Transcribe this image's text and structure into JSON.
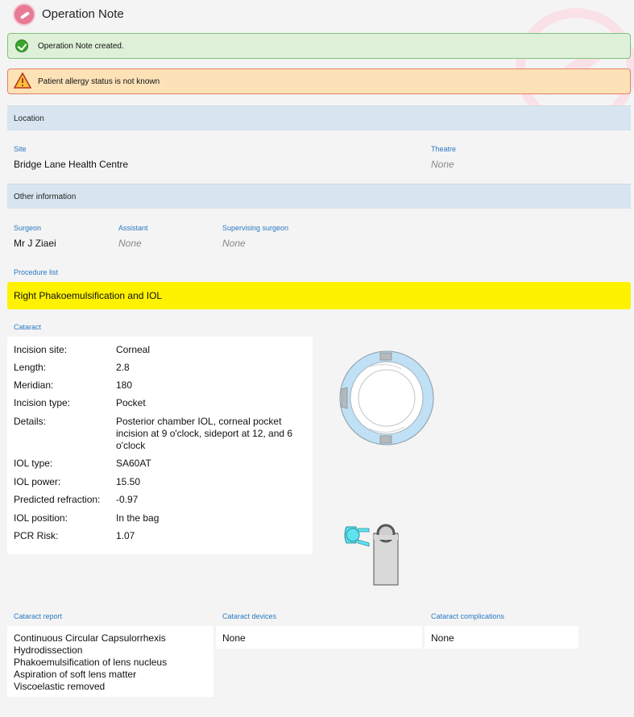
{
  "header": {
    "title": "Operation Note"
  },
  "alerts": {
    "success": "Operation Note created.",
    "warning": "Patient allergy status is not known"
  },
  "location": {
    "heading": "Location",
    "site_label": "Site",
    "site_value": "Bridge Lane Health Centre",
    "theatre_label": "Theatre",
    "theatre_value": "None"
  },
  "other": {
    "heading": "Other information",
    "surgeon_label": "Surgeon",
    "surgeon_value": "Mr J Ziaei",
    "assistant_label": "Assistant",
    "assistant_value": "None",
    "supervising_label": "Supervising surgeon",
    "supervising_value": "None"
  },
  "procedure": {
    "label": "Procedure list",
    "item": "Right Phakoemulsification and IOL"
  },
  "cataract": {
    "label": "Cataract",
    "rows": [
      {
        "label": "Incision site:",
        "value": "Corneal"
      },
      {
        "label": "Length:",
        "value": "2.8"
      },
      {
        "label": "Meridian:",
        "value": "180"
      },
      {
        "label": "Incision type:",
        "value": "Pocket"
      },
      {
        "label": "Details:",
        "value": "Posterior chamber IOL, corneal pocket incision at 9 o'clock, sideport at 12, and 6 o'clock"
      },
      {
        "label": "IOL type:",
        "value": "SA60AT"
      },
      {
        "label": "IOL power:",
        "value": "15.50"
      },
      {
        "label": "Predicted refraction:",
        "value": "-0.97"
      },
      {
        "label": "IOL position:",
        "value": "In the bag"
      },
      {
        "label": "PCR Risk:",
        "value": "1.07"
      }
    ]
  },
  "report": {
    "label": "Cataract report",
    "lines": [
      "Continuous Circular Capsulorrhexis",
      "Hydrodissection",
      "Phakoemulsification of lens nucleus",
      "Aspiration of soft lens matter",
      "Viscoelastic removed"
    ]
  },
  "devices": {
    "label": "Cataract devices",
    "value": "None"
  },
  "complications": {
    "label": "Cataract complications",
    "value": "None"
  },
  "colors": {
    "label_blue": "#2a79c4",
    "section_bar": "#d8e5f0",
    "procedure_highlight": "#fff200",
    "success_bg": "#dff0d8",
    "warning_bg": "#fde2b8"
  }
}
